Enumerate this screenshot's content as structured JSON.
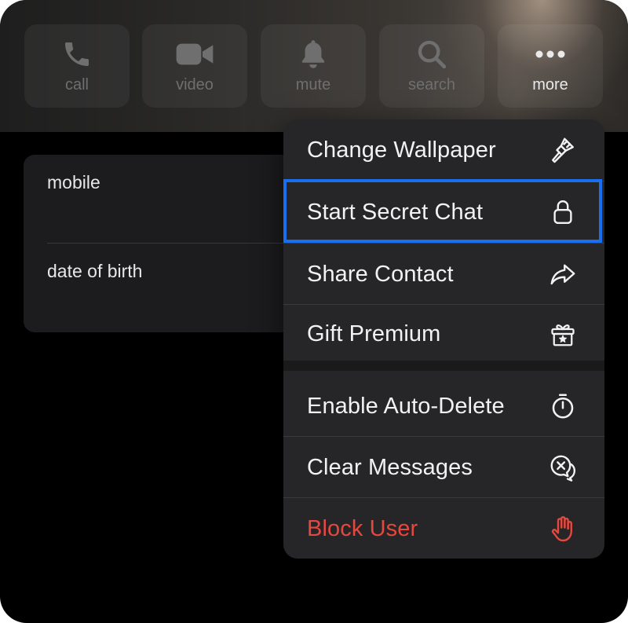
{
  "actions": [
    {
      "label": "call",
      "icon": "phone-icon"
    },
    {
      "label": "video",
      "icon": "video-camera-icon"
    },
    {
      "label": "mute",
      "icon": "bell-icon"
    },
    {
      "label": "search",
      "icon": "search-icon"
    },
    {
      "label": "more",
      "icon": "more-dots-icon"
    }
  ],
  "info": {
    "mobile_label": "mobile",
    "birth_label": "date of birth"
  },
  "menu": {
    "items": [
      {
        "label": "Change Wallpaper",
        "icon": "paintbrush-icon"
      },
      {
        "label": "Start Secret Chat",
        "icon": "lock-icon"
      },
      {
        "label": "Share Contact",
        "icon": "share-arrow-icon"
      },
      {
        "label": "Gift Premium",
        "icon": "gift-icon"
      },
      {
        "label": "Enable Auto-Delete",
        "icon": "timer-icon"
      },
      {
        "label": "Clear Messages",
        "icon": "clear-chat-icon"
      },
      {
        "label": "Block User",
        "icon": "hand-icon"
      }
    ],
    "highlighted": "Start Secret Chat"
  },
  "colors": {
    "background": "#000000",
    "menu_bg": "#262628",
    "card_bg": "#1c1c1e",
    "danger": "#e5483f",
    "focus": "#1a6ff0"
  }
}
